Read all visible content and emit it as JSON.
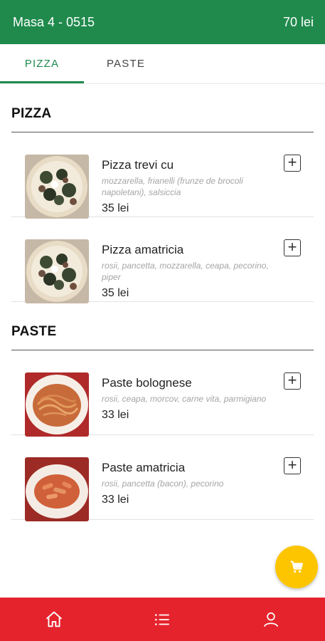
{
  "header": {
    "title": "Masa 4 - 0515",
    "total": "70 lei"
  },
  "tabs": [
    {
      "label": "PIZZA"
    },
    {
      "label": "PASTE"
    }
  ],
  "sections": [
    {
      "title": "PIZZA",
      "items": [
        {
          "name": "Pizza trevi cu",
          "desc": "mozzarella, frianelli (frunze de brocoli napoletani), salsiccia",
          "price": "35 lei"
        },
        {
          "name": "Pizza amatricia",
          "desc": "rosii, pancetta, mozzarella, ceapa, pecorino, piper",
          "price": "35 lei"
        }
      ]
    },
    {
      "title": "PASTE",
      "items": [
        {
          "name": "Paste bolognese",
          "desc": "rosii, ceapa, morcov, carne vita, parmigiano",
          "price": "33 lei"
        },
        {
          "name": "Paste amatricia",
          "desc": "rosii, pancetta (bacon), pecorino",
          "price": "33 lei"
        }
      ]
    }
  ],
  "icons": {
    "add": "plus-square-icon",
    "cart": "cart-icon",
    "home": "home-icon",
    "menu": "list-icon",
    "profile": "user-icon"
  },
  "colors": {
    "header": "#1f8a4c",
    "bottom_bar": "#e5232d",
    "fab": "#fdc500"
  }
}
